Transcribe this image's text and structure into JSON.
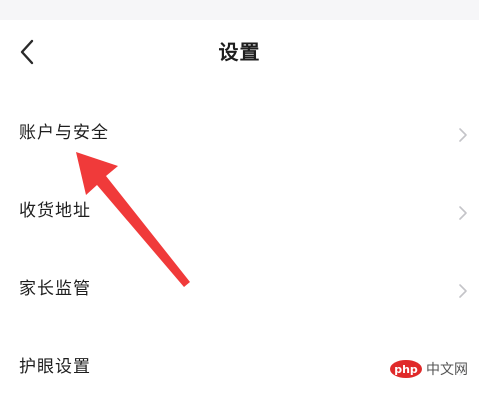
{
  "header": {
    "back_icon": "chevron-left-icon",
    "title": "设置"
  },
  "settings": {
    "items": [
      {
        "label": "账户与安全",
        "icon": "chevron-right-icon"
      },
      {
        "label": "收货地址",
        "icon": "chevron-right-icon"
      },
      {
        "label": "家长监管",
        "icon": "chevron-right-icon"
      },
      {
        "label": "护眼设置",
        "icon": "chevron-right-icon"
      }
    ]
  },
  "annotation": {
    "color": "#f03a3a",
    "target": "账户与安全"
  },
  "watermark": {
    "logo_text": "php",
    "text": "中文网"
  },
  "colors": {
    "text": "#1e1e1e",
    "chevron": "#c4c4c8",
    "status_strip": "#f6f6f8"
  }
}
